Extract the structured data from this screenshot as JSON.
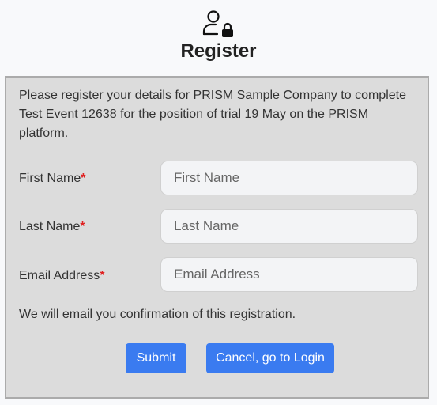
{
  "header": {
    "icon": "user-lock-icon",
    "title": "Register"
  },
  "form": {
    "intro": "Please register your details for PRISM Sample Company to complete Test Event 12638 for the position of trial 19 May on the PRISM platform.",
    "required_marker": "*",
    "fields": [
      {
        "label": "First Name",
        "placeholder": "First Name",
        "value": ""
      },
      {
        "label": "Last Name",
        "placeholder": "Last Name",
        "value": ""
      },
      {
        "label": "Email Address",
        "placeholder": "Email Address",
        "value": ""
      }
    ],
    "confirmation_note": "We will email you confirmation of this registration.",
    "submit_label": "Submit",
    "cancel_label": "Cancel, go to Login"
  },
  "colors": {
    "accent": "#3a7bf0",
    "required": "#e02020",
    "panel_bg": "#dcdcdc",
    "page_bg": "#f8f9fb"
  }
}
